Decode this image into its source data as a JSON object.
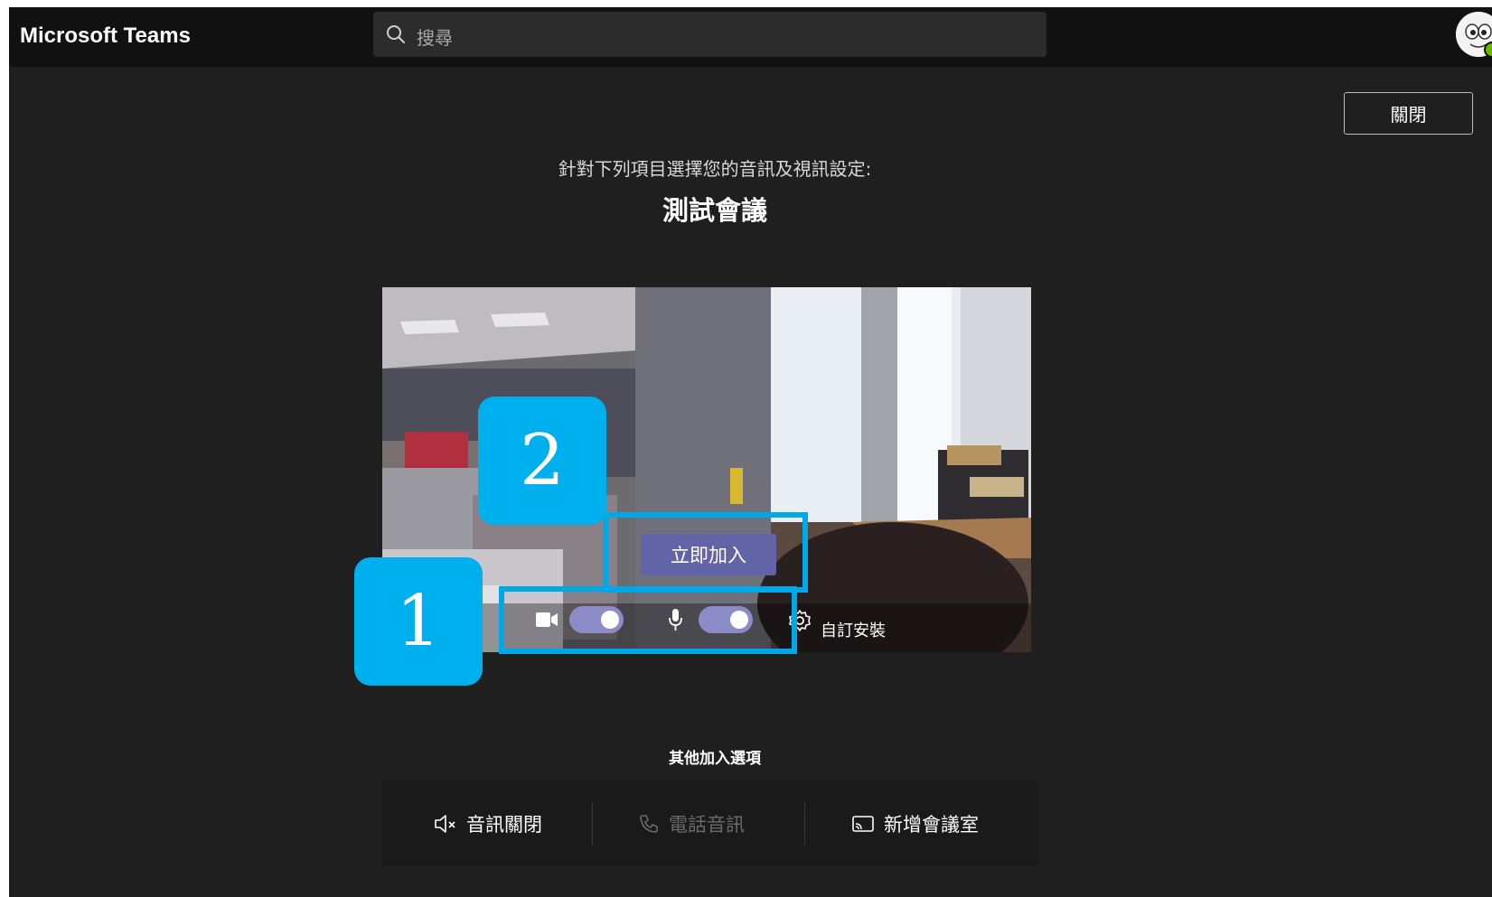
{
  "app": {
    "title": "Microsoft Teams"
  },
  "search": {
    "placeholder": "搜尋"
  },
  "header": {
    "close_label": "關閉"
  },
  "setup": {
    "subtitle": "針對下列項目選擇您的音訊及視訊設定:",
    "meeting_title": "測試會議",
    "join_label": "立即加入",
    "camera_on": true,
    "mic_on": true,
    "custom_setup_label": "自訂安裝"
  },
  "callouts": {
    "one": "1",
    "two": "2"
  },
  "other_options": {
    "title": "其他加入選項",
    "items": [
      {
        "label": "音訊關閉",
        "icon": "speaker-off-icon",
        "enabled": true
      },
      {
        "label": "電話音訊",
        "icon": "phone-icon",
        "enabled": false
      },
      {
        "label": "新增會議室",
        "icon": "cast-icon",
        "enabled": true
      }
    ]
  },
  "colors": {
    "accent": "#6264a7",
    "toggle_on": "#8b8cc7",
    "callout": "#00b0ee",
    "background": "#1f1f1f",
    "topbar": "#111111"
  }
}
